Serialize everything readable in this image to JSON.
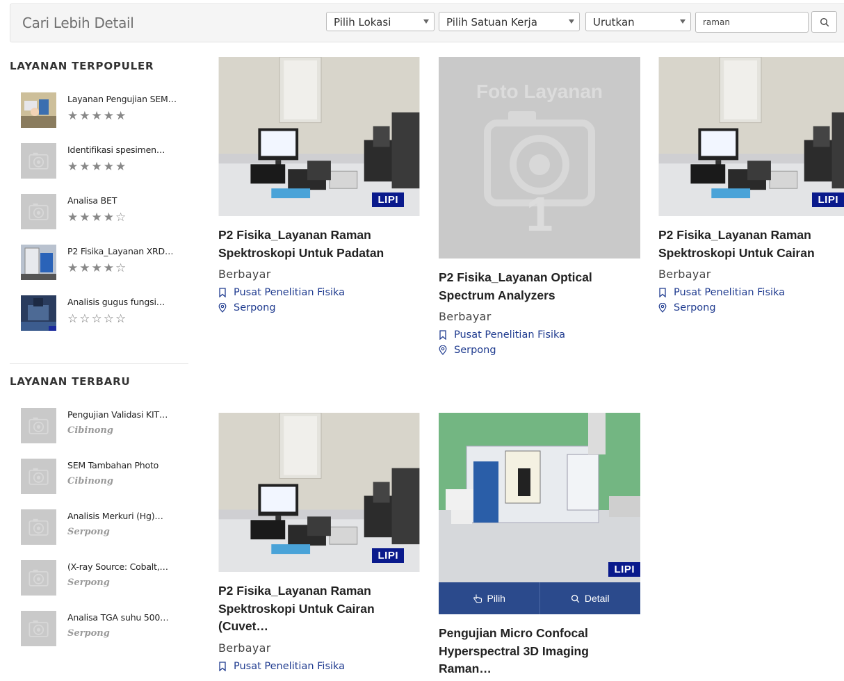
{
  "header": {
    "title": "Cari Lebih Detail",
    "location_select": "Pilih Lokasi",
    "unit_select": "Pilih Satuan Kerja",
    "sort_select": "Urutkan",
    "search_value": "raman"
  },
  "sidebar": {
    "popular_heading": "LAYANAN TERPOPULER",
    "popular": [
      {
        "title": "Layanan Pengujian SEM…",
        "stars": "★★★★★"
      },
      {
        "title": "Identifikasi spesimen…",
        "stars": "★★★★★"
      },
      {
        "title": "Analisa BET",
        "stars": "★★★★☆"
      },
      {
        "title": "P2 Fisika_Layanan XRD…",
        "stars": "★★★★☆"
      },
      {
        "title": "Analisis gugus fungsi…",
        "stars": "☆☆☆☆☆"
      }
    ],
    "newest_heading": "LAYANAN TERBARU",
    "newest": [
      {
        "title": "Pengujian Validasi KIT…",
        "location": "Cibinong"
      },
      {
        "title": "SEM Tambahan Photo",
        "location": "Cibinong"
      },
      {
        "title": "Analisis Merkuri (Hg)…",
        "location": "Serpong"
      },
      {
        "title": "(X-ray Source: Cobalt,…",
        "location": "Serpong"
      },
      {
        "title": "Analisa TGA suhu 500…",
        "location": "Serpong"
      }
    ]
  },
  "placeholder": {
    "line1": "Foto Layanan",
    "line2": "1"
  },
  "cards": [
    {
      "title": "P2 Fisika_Layanan Raman Spektroskopi Untuk Padatan",
      "price": "Berbayar",
      "unit": "Pusat Penelitian Fisika",
      "location": "Serpong",
      "badge": "LIPI"
    },
    {
      "title": "P2 Fisika_Layanan Optical Spectrum Analyzers",
      "price": "Berbayar",
      "unit": "Pusat Penelitian Fisika",
      "location": "Serpong"
    },
    {
      "title": "P2 Fisika_Layanan Raman Spektroskopi Untuk Cairan",
      "price": "Berbayar",
      "unit": "Pusat Penelitian Fisika",
      "location": "Serpong",
      "badge": "LIPI"
    },
    {
      "title": "P2 Fisika_Layanan Raman Spektroskopi Untuk Cairan (Cuvet…",
      "price": "Berbayar",
      "unit": "Pusat Penelitian Fisika",
      "badge": "LIPI"
    },
    {
      "title": "Pengujian Micro Confocal Hyperspectral 3D Imaging Raman…",
      "badge": "LIPI",
      "action_select": "Pilih",
      "action_detail": "Detail"
    }
  ]
}
